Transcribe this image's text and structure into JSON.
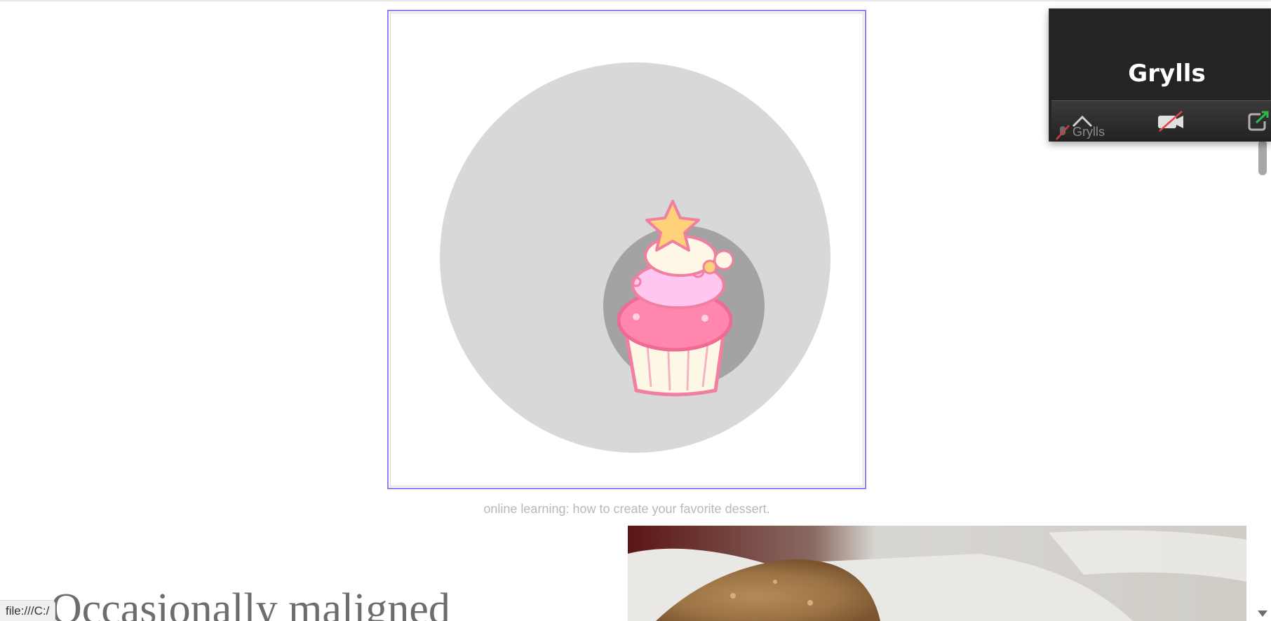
{
  "call": {
    "participant_name": "Grylls",
    "toolbar_label": "Grylls",
    "icons": [
      "chevron-up-icon",
      "mic-off-icon",
      "video-off-icon",
      "popout-icon"
    ]
  },
  "media": {
    "caption": "online learning: how to create your favorite dessert.",
    "icon": "cupcake-icon"
  },
  "article": {
    "headline": "Occasionally maligned"
  },
  "status_bar": {
    "url": "file:///C:/"
  },
  "colors": {
    "frame_border": "#9b7cf2",
    "call_bg": "#242424",
    "caption": "#b8b8b8",
    "avatar_outer": "#d8d8d8",
    "avatar_inner": "#a3a3a3"
  }
}
